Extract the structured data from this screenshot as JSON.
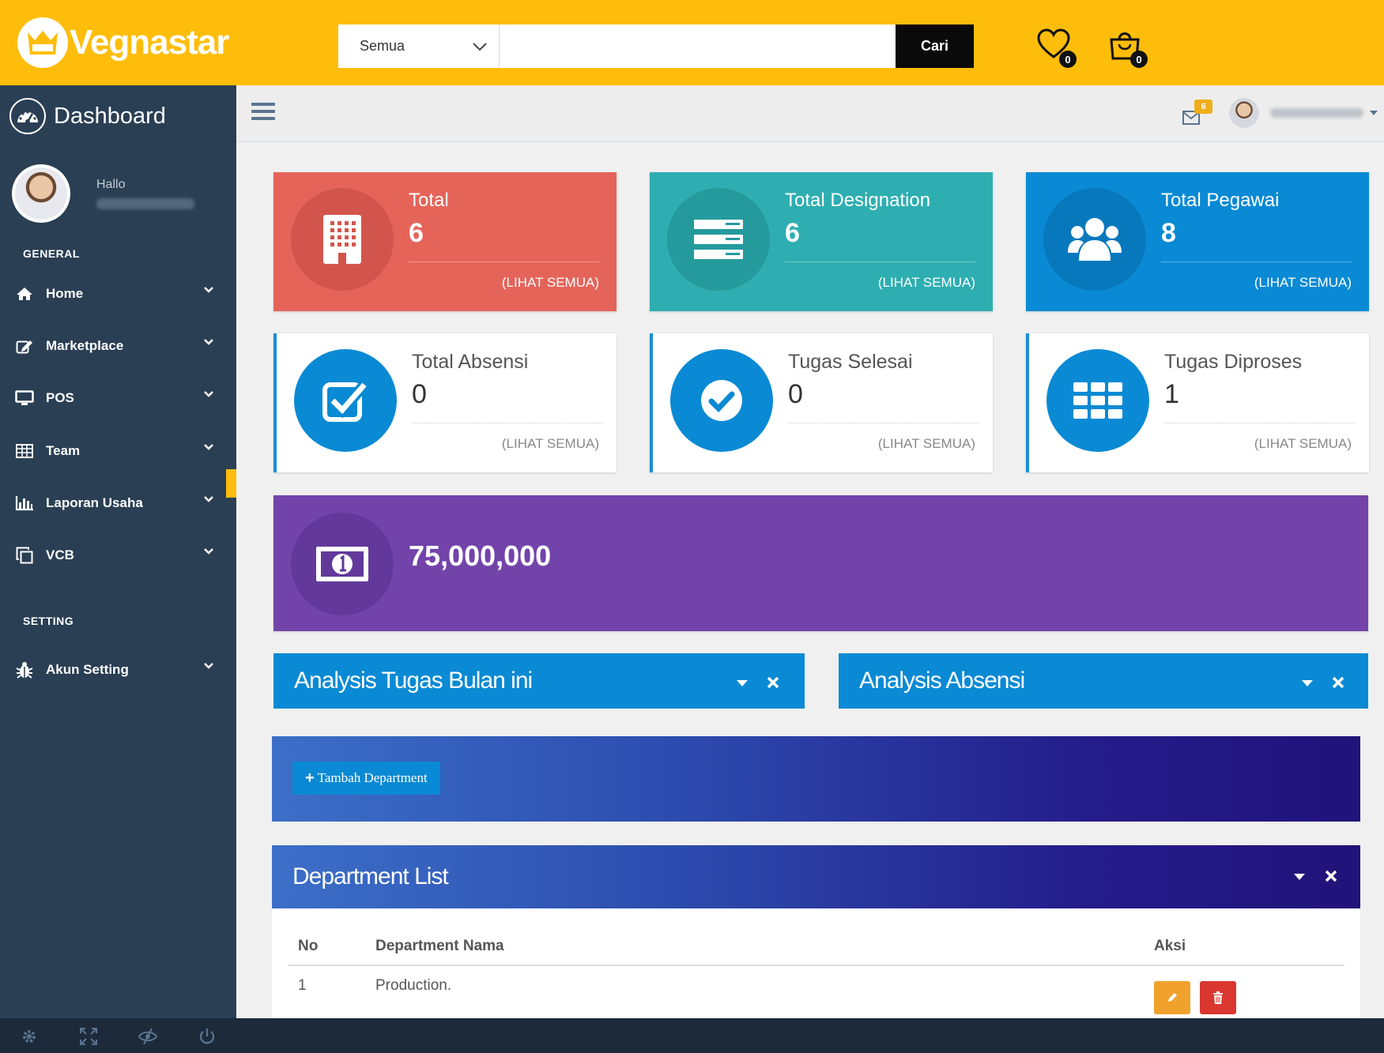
{
  "app": {
    "name": "Vegnastar"
  },
  "topbar": {
    "search_category": "Semua",
    "search_placeholder": "",
    "search_button": "Cari",
    "wishlist_count": "0",
    "cart_count": "0",
    "accent_color": "#ffbd0b"
  },
  "sidebar": {
    "title": "Dashboard",
    "greeting": "Hallo",
    "sections": {
      "general": "GENERAL",
      "setting": "SETTING"
    },
    "items": [
      {
        "label": "Home",
        "icon": "home-icon"
      },
      {
        "label": "Marketplace",
        "icon": "edit-icon"
      },
      {
        "label": "POS",
        "icon": "desktop-icon"
      },
      {
        "label": "Team",
        "icon": "table-icon"
      },
      {
        "label": "Laporan Usaha",
        "icon": "bar-chart-icon"
      },
      {
        "label": "VCB",
        "icon": "copy-icon"
      },
      {
        "label": "Akun Setting",
        "icon": "bug-icon"
      }
    ],
    "active_item": "POS"
  },
  "header": {
    "mail_count": "6"
  },
  "tiles": [
    {
      "title": "Total",
      "value": "6",
      "link": "(LIHAT SEMUA)",
      "color": "#e5645a",
      "icon": "building-icon"
    },
    {
      "title": "Total Designation",
      "value": "6",
      "link": "(LIHAT SEMUA)",
      "color": "#2eaeb1",
      "icon": "list-icon"
    },
    {
      "title": "Total Pegawai",
      "value": "8",
      "link": "(LIHAT SEMUA)",
      "color": "#0a8ad4",
      "icon": "users-icon"
    },
    {
      "title": "Total Absensi",
      "value": "0",
      "link": "(LIHAT SEMUA)",
      "icon": "check-square-icon"
    },
    {
      "title": "Tugas Selesai",
      "value": "0",
      "link": "(LIHAT SEMUA)",
      "icon": "check-circle-icon"
    },
    {
      "title": "Tugas Diproses",
      "value": "1",
      "link": "(LIHAT SEMUA)",
      "icon": "grid-icon"
    }
  ],
  "money": {
    "value": "75,000,000",
    "icon": "money-icon"
  },
  "panels": {
    "tugas": "Analysis Tugas Bulan ini",
    "absensi": "Analysis Absensi"
  },
  "department": {
    "add_button": "Tambah Department",
    "list_title": "Department List",
    "columns": [
      "No",
      "Department Nama",
      "Aksi"
    ],
    "rows": [
      {
        "no": "1",
        "name": "Production."
      }
    ]
  }
}
